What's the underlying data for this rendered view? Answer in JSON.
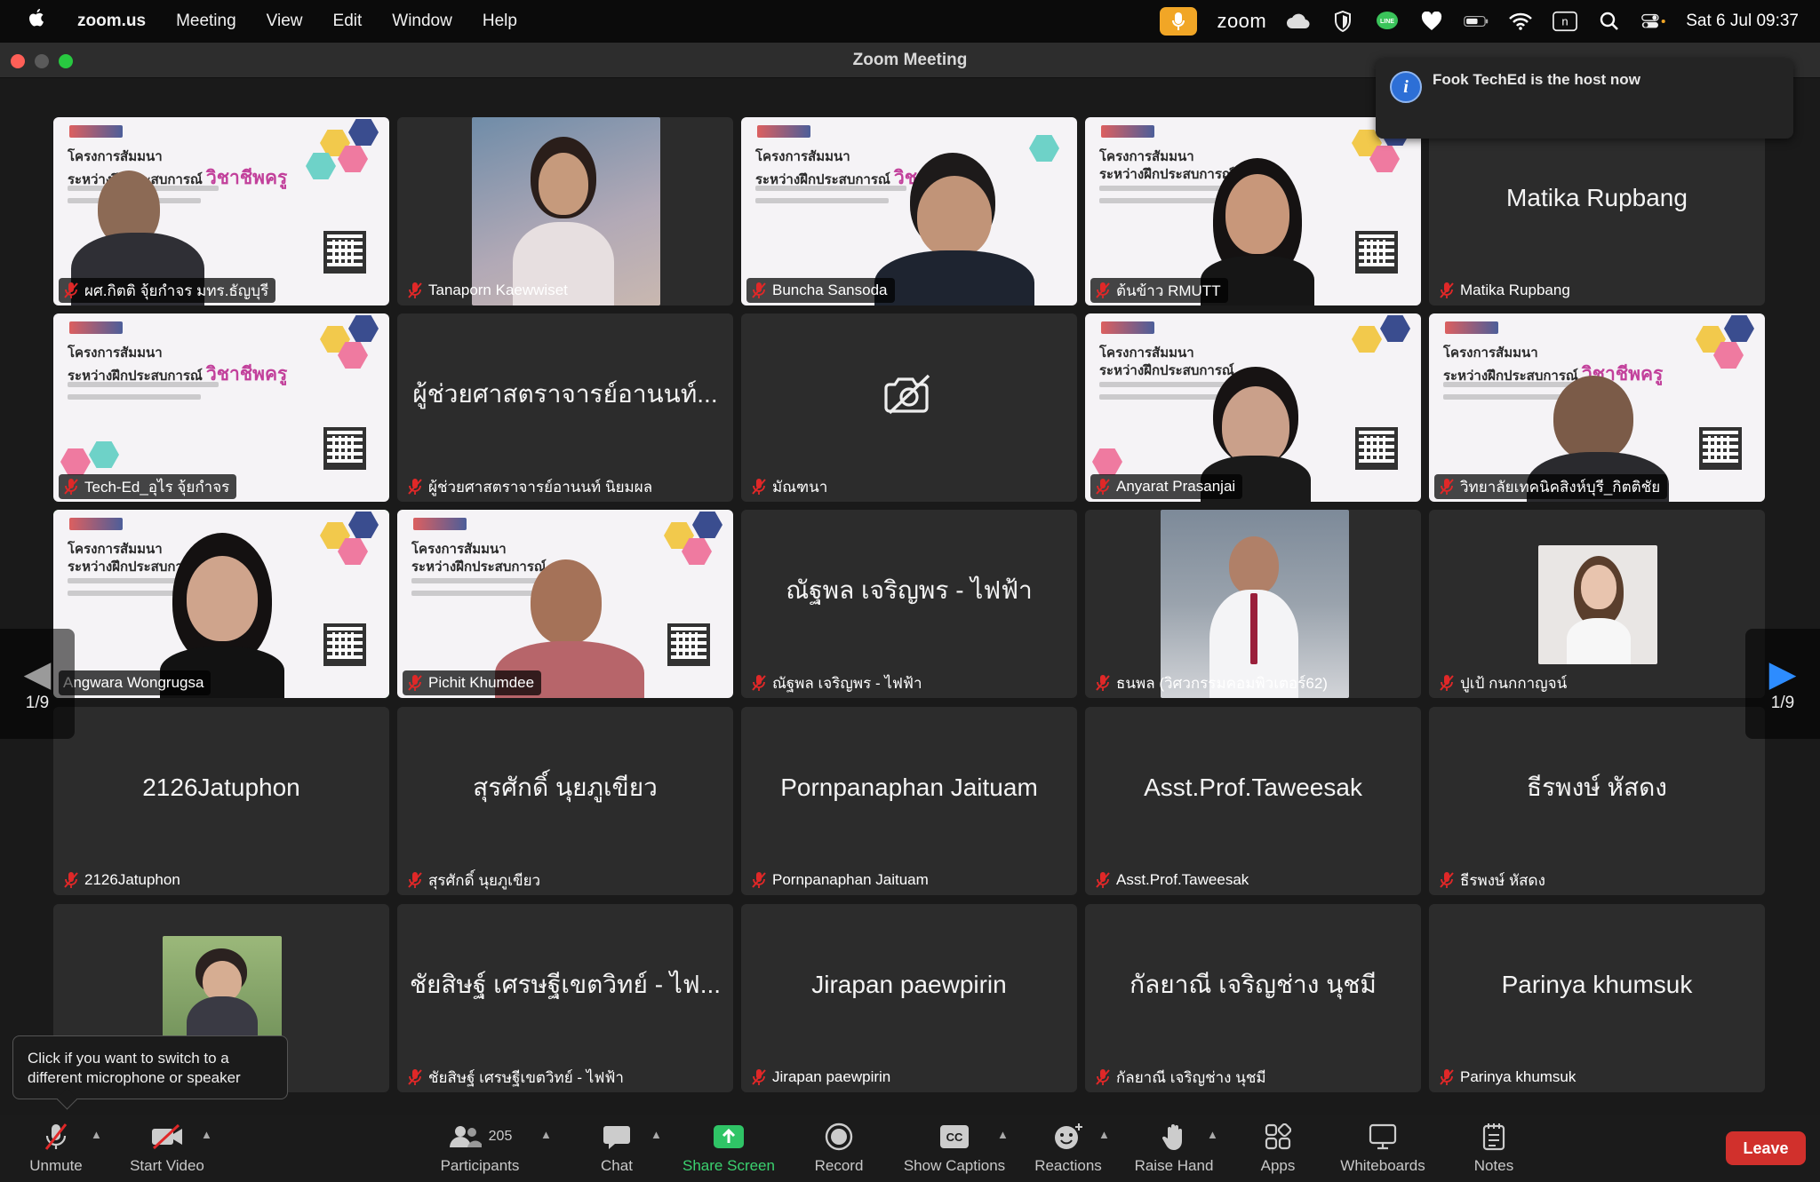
{
  "menubar": {
    "app": "zoom.us",
    "menus": [
      "Meeting",
      "View",
      "Edit",
      "Window",
      "Help"
    ],
    "status_app": "zoom",
    "clock": "Sat 6 Jul  09:37",
    "line_badge": "LINE",
    "keyboard_badge": "n"
  },
  "window": {
    "title": "Zoom Meeting"
  },
  "notification": {
    "text": "Fook TechEd is the host now",
    "icon": "info-icon"
  },
  "slide_text": {
    "line1": "โครงการสัมมนา",
    "line2a": "ระหว่างฝึกประสบการณ์",
    "line2b": "วิชาชีพครู"
  },
  "tiles": [
    {
      "label": "ผศ.กิตติ จุ้ยกำจร มทร.ธัญบุรี",
      "big": ""
    },
    {
      "label": "Tanaporn Kaewwiset",
      "big": ""
    },
    {
      "label": "Buncha Sansoda",
      "big": ""
    },
    {
      "label": "ต้นข้าว RMUTT",
      "big": ""
    },
    {
      "label": "Matika Rupbang",
      "big": "Matika Rupbang"
    },
    {
      "label": "Tech-Ed_อุไร จุ้ยกำจร",
      "big": ""
    },
    {
      "label": "ผู้ช่วยศาสตราจารย์อานนท์ นิยมผล",
      "big": "ผู้ช่วยศาสตราจารย์อานนท์..."
    },
    {
      "label": "มัณฑนา",
      "big": ""
    },
    {
      "label": "Anyarat Prasanjai",
      "big": ""
    },
    {
      "label": "วิทยาลัยเทคนิคสิงห์บุรี_กิตติชัย",
      "big": ""
    },
    {
      "label": "Angwara Wongrugsa",
      "big": ""
    },
    {
      "label": "Pichit Khumdee",
      "big": ""
    },
    {
      "label": "ณัฐพล เจริญพร - ไฟฟ้า",
      "big": "ณัฐพล เจริญพร - ไฟฟ้า"
    },
    {
      "label": "ธนพล (วิศวกรรมคอมพิวเตอร์62)",
      "big": ""
    },
    {
      "label": "ปูเป้ กนกกาญจน์",
      "big": ""
    },
    {
      "label": "2126Jatuphon",
      "big": "2126Jatuphon"
    },
    {
      "label": "สุรศักดิ์ นุยภูเขียว",
      "big": "สุรศักดิ์ นุยภูเขียว"
    },
    {
      "label": "Pornpanaphan Jaituam",
      "big": "Pornpanaphan Jaituam"
    },
    {
      "label": "Asst.Prof.Taweesak",
      "big": "Asst.Prof.Taweesak"
    },
    {
      "label": "ธีรพงษ์ หัสดง",
      "big": "ธีรพงษ์ หัสดง"
    },
    {
      "label": "",
      "big": ""
    },
    {
      "label": "ชัยสิษฐ์ เศรษฐีเขตวิทย์ - ไฟฟ้า",
      "big": "ชัยสิษฐ์ เศรษฐีเขตวิทย์ - ไฟ..."
    },
    {
      "label": "Jirapan paewpirin",
      "big": "Jirapan paewpirin"
    },
    {
      "label": "กัลยาณี เจริญช่าง นุชมี",
      "big": "กัลยาณี เจริญช่าง นุชมี"
    },
    {
      "label": "Parinya khumsuk",
      "big": "Parinya khumsuk"
    }
  ],
  "pager": {
    "left": "1/9",
    "right": "1/9"
  },
  "tooltip": "Click if you want to switch to a different microphone or speaker",
  "toolbar": {
    "unmute": "Unmute",
    "start_video": "Start Video",
    "participants": "Participants",
    "participants_count": "205",
    "chat": "Chat",
    "share": "Share Screen",
    "record": "Record",
    "captions": "Show Captions",
    "captions_icon_text": "CC",
    "reactions": "Reactions",
    "raise_hand": "Raise Hand",
    "apps": "Apps",
    "whiteboards": "Whiteboards",
    "notes": "Notes",
    "leave": "Leave"
  },
  "colors": {
    "accent_green": "#44d05a",
    "leave_red": "#d1302c",
    "share_green": "#3bd16f",
    "blue": "#2d8cff",
    "mic_orange": "#f1a626"
  }
}
